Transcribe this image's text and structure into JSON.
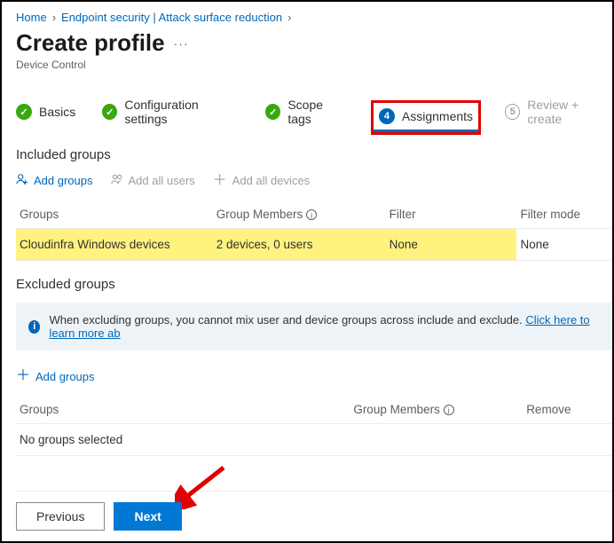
{
  "breadcrumb": {
    "home": "Home",
    "path": "Endpoint security | Attack surface reduction"
  },
  "page": {
    "title": "Create profile",
    "subtitle": "Device Control"
  },
  "stepper": {
    "s1": "Basics",
    "s2": "Configuration settings",
    "s3": "Scope tags",
    "s4_num": "4",
    "s4": "Assignments",
    "s5_num": "5",
    "s5": "Review + create"
  },
  "included": {
    "heading": "Included groups",
    "add_groups": "Add groups",
    "add_all_users": "Add all users",
    "add_all_devices": "Add all devices",
    "cols": {
      "groups": "Groups",
      "members": "Group Members",
      "filter": "Filter",
      "filter_mode": "Filter mode"
    },
    "row": {
      "name": "Cloudinfra Windows devices",
      "members": "2 devices, 0 users",
      "filter": "None",
      "filter_mode": "None"
    }
  },
  "excluded": {
    "heading": "Excluded groups",
    "note_text": "When excluding groups, you cannot mix user and device groups across include and exclude. ",
    "note_link": "Click here to learn more ab",
    "add_groups": "Add groups",
    "cols": {
      "groups": "Groups",
      "members": "Group Members",
      "remove": "Remove"
    },
    "empty": "No groups selected"
  },
  "footer": {
    "previous": "Previous",
    "next": "Next"
  }
}
